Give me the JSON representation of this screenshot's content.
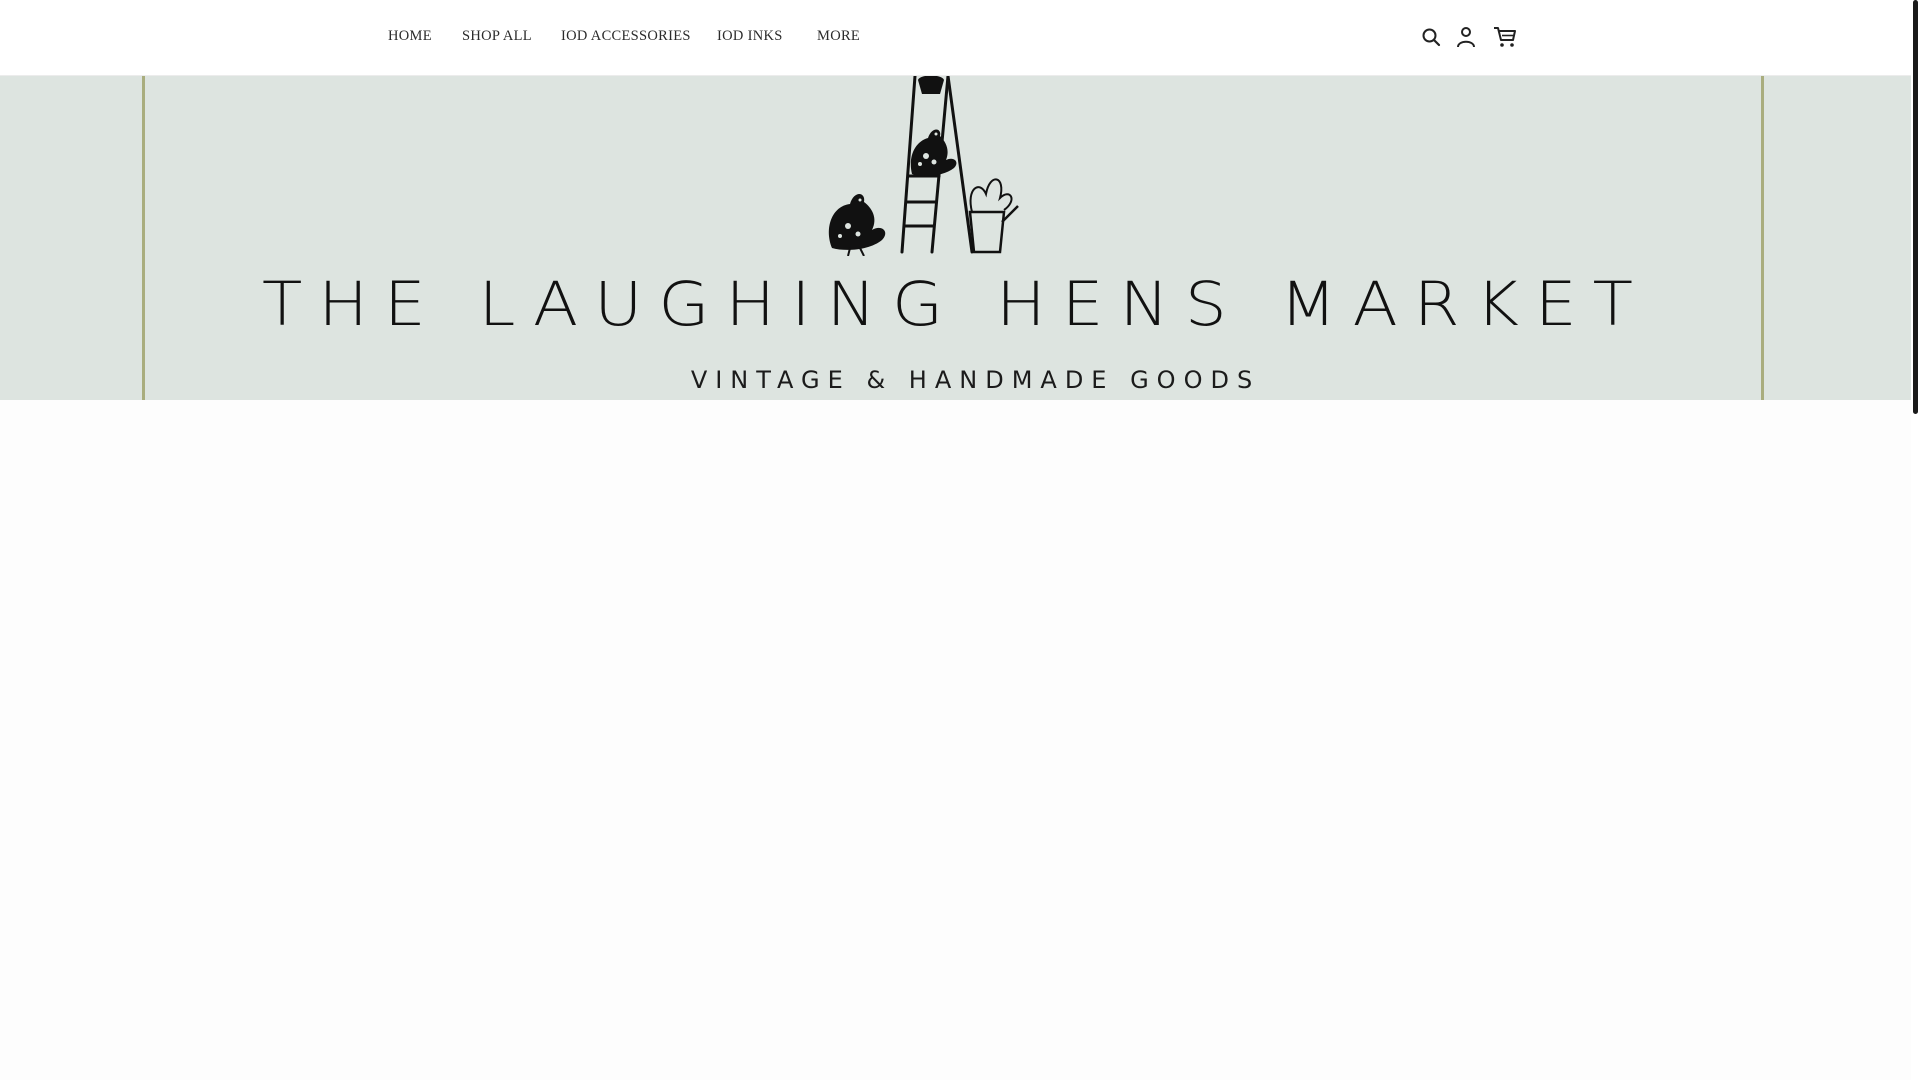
{
  "nav": {
    "home": "HOME",
    "shop_all": "SHOP ALL",
    "iod_accessories": "IOD ACCESSORIES",
    "iod_inks": "IOD INKS",
    "more": "MORE"
  },
  "header_icons": [
    "search-icon",
    "account-icon",
    "cart-icon"
  ],
  "banner": {
    "title": "THE LAUGHING HENS MARKET",
    "subtitle": "VINTAGE & HANDMADE GOODS"
  },
  "colors": {
    "banner_bg": "#dde4e0",
    "frame_line": "#a9ad7e",
    "text": "#2b2b2b"
  }
}
